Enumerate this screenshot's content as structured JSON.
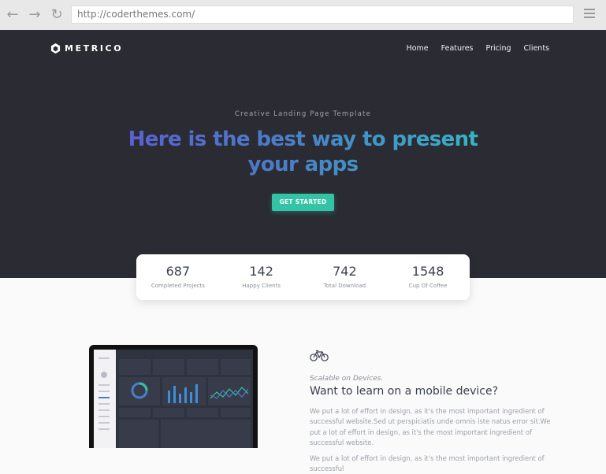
{
  "browser": {
    "url": "http://coderthemes.com/",
    "back_icon": "←",
    "forward_icon": "→",
    "reload_icon": "↻"
  },
  "brand": {
    "name": "METRICO"
  },
  "nav": {
    "items": [
      "Home",
      "Features",
      "Pricing",
      "Clients"
    ]
  },
  "hero": {
    "eyebrow": "Creative Landing Page Template",
    "headline": "Here is the best way to present your apps",
    "cta": "GET STARTED"
  },
  "stats": [
    {
      "value": "687",
      "label": "Completed Projects"
    },
    {
      "value": "142",
      "label": "Happy Clients"
    },
    {
      "value": "742",
      "label": "Total Download"
    },
    {
      "value": "1548",
      "label": "Cup Of Coffee"
    }
  ],
  "feature": {
    "subtitle": "Scalable on Devices.",
    "title": "Want to learn on a mobile device?",
    "text": "We put a lot of effort in design, as it's the most important ingredient of successful website.Sed ut perspiciatis unde omnis iste natus error sit.We put a lot of effort in design, as it's the most important ingredient of successful website.",
    "text2": "We put a lot of effort in design, as it's the most important ingredient of successful"
  },
  "colors": {
    "hero_bg": "#2b2c33",
    "accent": "#32c4a5",
    "gradient_start": "#5a5fd0",
    "gradient_end": "#35b6c6"
  }
}
